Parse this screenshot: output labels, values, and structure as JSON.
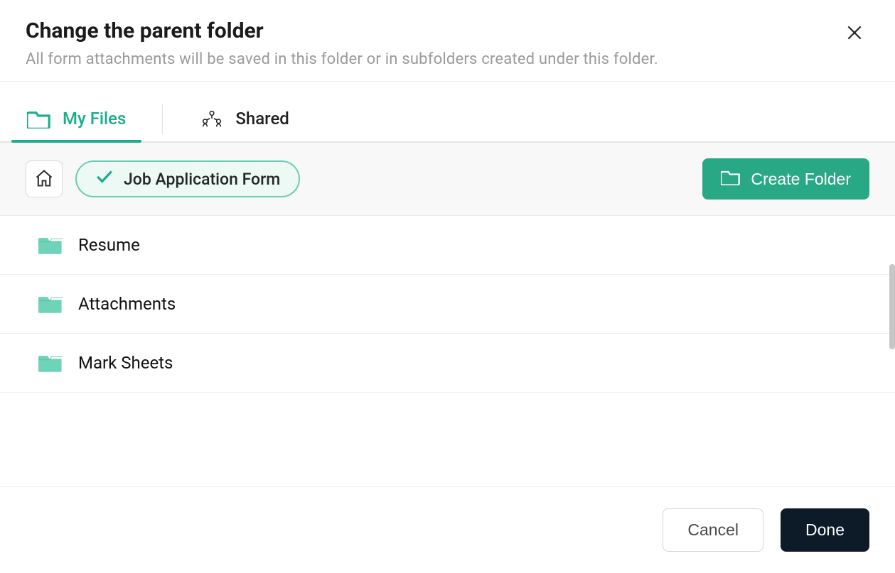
{
  "header": {
    "title": "Change the parent folder",
    "subtitle": "All form attachments will be saved in this folder or in subfolders created under this folder."
  },
  "tabs": [
    {
      "label": "My Files",
      "active": true
    },
    {
      "label": "Shared",
      "active": false
    }
  ],
  "toolbar": {
    "current_folder_label": "Job Application Form",
    "create_folder_label": "Create Folder"
  },
  "folders": [
    {
      "name": "Resume"
    },
    {
      "name": "Attachments"
    },
    {
      "name": "Mark Sheets"
    }
  ],
  "footer": {
    "cancel_label": "Cancel",
    "done_label": "Done"
  },
  "colors": {
    "accent": "#1aad8b",
    "primary_button": "#0d1b28",
    "folder_fill": "#6ed3b8"
  }
}
